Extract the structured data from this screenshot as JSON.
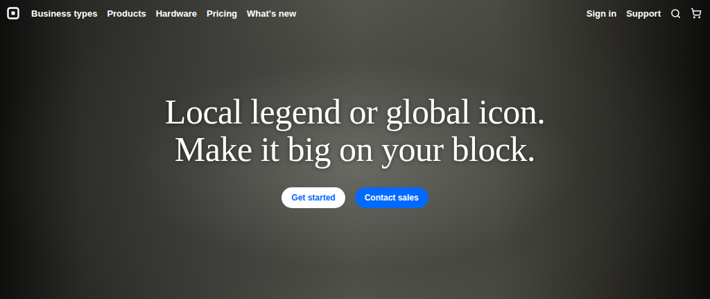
{
  "nav": {
    "links": [
      "Business types",
      "Products",
      "Hardware",
      "Pricing",
      "What's new"
    ],
    "right_links": [
      "Sign in",
      "Support"
    ]
  },
  "hero": {
    "headline_lines": [
      "Local legend or global icon.",
      "Make it big on your block."
    ],
    "buttons": [
      {
        "label": "Get started",
        "kind": "secondary"
      },
      {
        "label": "Contact sales",
        "kind": "primary"
      }
    ]
  }
}
